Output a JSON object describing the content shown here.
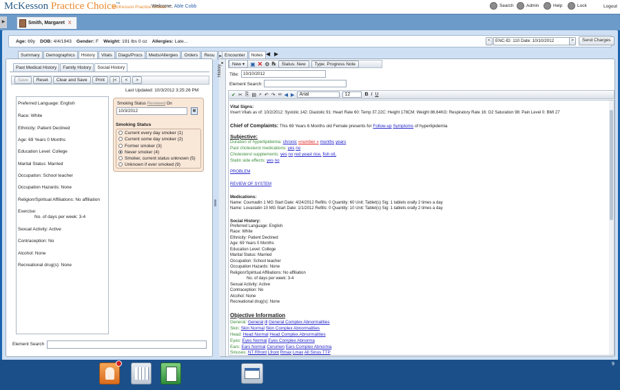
{
  "app": {
    "brand": "McKesson",
    "brand_accent": "Practice Choice",
    "brand_tm": "™",
    "sub": "McKesson Practice Choice",
    "welcome": "Welcome,",
    "user": "Able Cobb"
  },
  "topnav": [
    {
      "label": "Search",
      "icon": "search-icon"
    },
    {
      "label": "Admin",
      "icon": "gear-icon"
    },
    {
      "label": "Help",
      "icon": "help-icon"
    },
    {
      "label": "Lock",
      "icon": "lock-icon"
    },
    {
      "label": "Logout",
      "icon": ""
    }
  ],
  "patient_tab": {
    "name": "Smith, Margaret",
    "close": "X"
  },
  "patient": {
    "age_l": "Age:",
    "age": "69y",
    "dob_l": "DOB:",
    "dob": "4/4/1943",
    "gender_l": "Gender:",
    "gender": "F",
    "weight_l": "Weight:",
    "weight": "191 lbs 0 oz",
    "allergies_l": "Allergies:",
    "allergies": "Late...",
    "enc": "ENC-ID: 110 Date: 10/10/2012",
    "enc_prev": "<",
    "enc_next": ">",
    "send": "Send Charges"
  },
  "left_tabs": [
    "Summary",
    "Demographics",
    "History",
    "Vitals",
    "Diags/Procs",
    "Meds/Allergies",
    "Orders",
    "Resu"
  ],
  "left_tab_next": "▸",
  "history_tabs": [
    "Past Medical History",
    "Family History",
    "Social History"
  ],
  "toolbar": [
    "Save",
    "Reset",
    "Clear and Save",
    "Print",
    "|<",
    "<",
    ">"
  ],
  "last_updated": "Last Updated:   10/3/2012 3:25:26 PM",
  "social": [
    {
      "t": "Preferred Language: English"
    },
    {
      "t": "Race: White"
    },
    {
      "t": "Ethnicity: Patient Declined"
    },
    {
      "t": "Age: 69 Years 0 Months"
    },
    {
      "t": "Education Level: College"
    },
    {
      "t": "Marital Status:  Married"
    },
    {
      "t": "Occupation: School teacher"
    },
    {
      "t": "Occupation Hazards:  None"
    },
    {
      "t": "Religion/Spiritual Affiliations:  No affiliation"
    },
    {
      "t": "Exercise:"
    },
    {
      "t": "No. of days per week: 3-4"
    },
    {
      "t": "Sexual Activity: Active"
    },
    {
      "t": "Contraception:  No"
    },
    {
      "t": "Alcohol: None"
    },
    {
      "t": "Recreational drug(s): None"
    }
  ],
  "smoking": {
    "label": "Smoking Status",
    "reviewed": "Reviewed",
    "on": "On",
    "date": "10/3/2012",
    "title": "Smoking Status",
    "options": [
      "Current every day smoker (1)",
      "Current some day smoker (2)",
      "Former smoker (3)",
      "Never smoker (4)",
      "Smoker, current status unknown (5)",
      "Unknown if ever smoked (9)"
    ],
    "selected": 3
  },
  "element_search": "Element Search",
  "right_tabs": [
    "Encounter",
    "Notes"
  ],
  "right_arrows": [
    "🡐",
    "🡒"
  ],
  "history_label": "History",
  "note_toolbar": {
    "new": "New",
    "status": "Status: New",
    "type": "Type: Progress Note"
  },
  "note": {
    "title_l": "Title:",
    "title": "10/10/2012",
    "search_l": "Element Search:"
  },
  "editor": {
    "font": "Arial",
    "size": "12",
    "bold": "B",
    "italic": "I",
    "underline": "U"
  },
  "content": {
    "vitals_h": "Vital Signs:",
    "vitals": "Insert Vitals as of: 10/2/2012: Systolic 142: Diastolic 91: Heart Rate 60: Temp 37.22C: Height 178CM: Weight 86.64KG: Respiratory Rate 16: O2 Saturation 98: Pain Level 0: BMI 27",
    "cc_h": "Chief of Complaints:",
    "cc": "This 69 Years 6 Months old Female presents for",
    "cc_l1": "Follow-up",
    "cc_l2": "Symptoms",
    "cc_end": "of hyperlipidemia",
    "subj_h": "Subjective:",
    "s1": "Duration of hyperlipidemia:",
    "s1a": "chronic",
    "s1b": "«number »",
    "s1c": "months",
    "s1d": "years",
    "s2": "Past cholesterol medications:",
    "s2a": "yes",
    "s2b": "no",
    "s3": "Cholesterol supplements:",
    "s3a": "yes",
    "s3b": "no",
    "s3c": "red yeast rice,",
    "s3d": "fish oil,",
    "s4": "Statin side effects:",
    "s4a": "yes",
    "s4b": "no",
    "problem": "PROBLEM",
    "ros": "REVIEW OF SYSTEM",
    "meds_h": "Medications:",
    "med1": "Name: Coumadin 1 MG Start Date: 4/24/2012 Refills: 0 Quantity: 60 Unit: Tablet(s) Sig: 1 tablets orally 2 times a day",
    "med2": "Name: Lovastatin 10 MG Start Date: 1/1/2012 Refills: 0 Quantity: 10 Unit: Tablet(s) Sig: 1 tablets orally 2 times a day",
    "soc_h": "Social History:",
    "soc": [
      "Preferred Language: English",
      "Race: White",
      "Ethnicity: Patient Declined",
      "Age: 69 Years 0 Months",
      "Education Level: College",
      "Marital Status:  Married",
      "Occupation: School teacher",
      "Occupation Hazards:  None",
      "Religion/Spiritual Affiliations:  No affiliation",
      "      No. of days per week: 3-4",
      "Sexual Activity: Active",
      "Contraception:  No",
      "Alcohol: None",
      "Recreational drug(s): None"
    ],
    "obj_h": "Objective Information",
    "obj": [
      {
        "k": "General:",
        "v": [
          "General",
          "ill",
          "General Complex Abnormalities"
        ]
      },
      {
        "k": "Skin:",
        "v": [
          "Skin Normal",
          "Skin Complex Abnormalities"
        ]
      },
      {
        "k": "Head:",
        "v": [
          "Head Normal",
          "Head Complex Abnormalities"
        ]
      },
      {
        "k": "Eyes:",
        "v": [
          "Eyes Normal",
          "Eyes Complex Abnorma"
        ]
      },
      {
        "k": "Ears:",
        "v": [
          "Ears Normal",
          "Cerumen",
          "Ears Complex Abnorma"
        ]
      },
      {
        "k": "Sinuses:",
        "v": [
          "NT Rfront",
          "Lfront",
          "Rmax",
          "Lmax",
          "All Sinus TTP"
        ]
      }
    ]
  }
}
